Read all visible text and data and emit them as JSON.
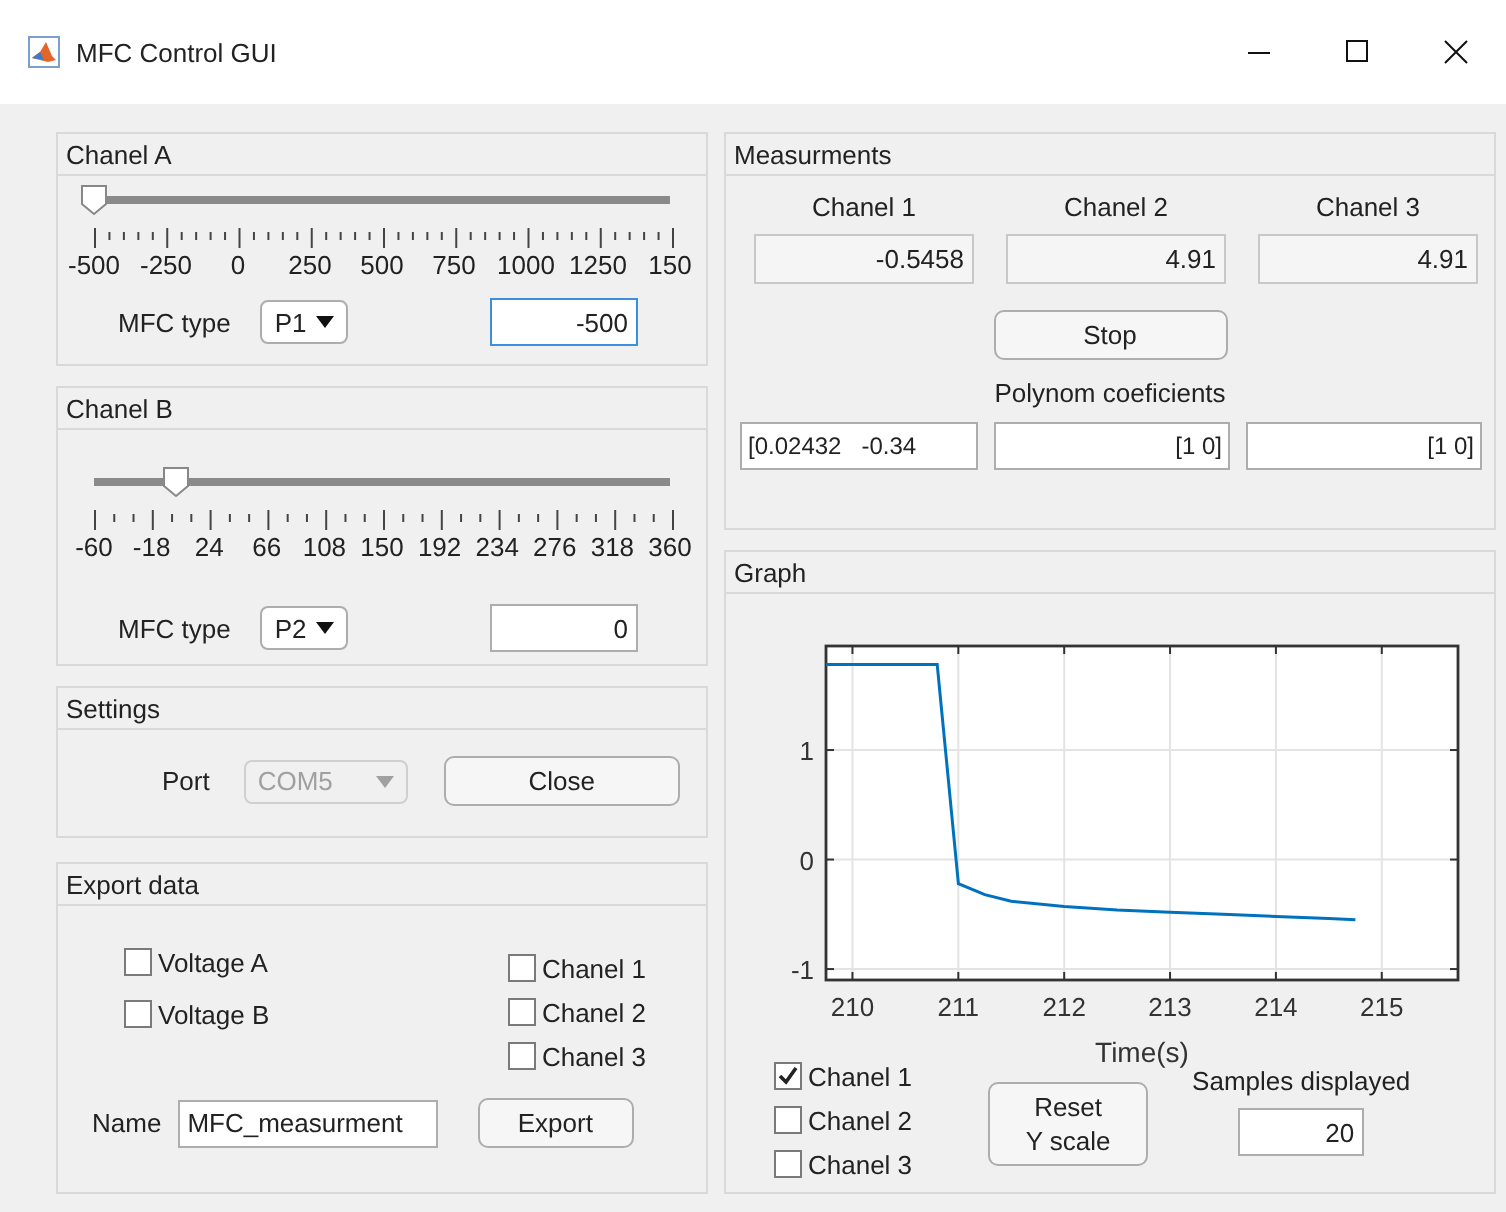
{
  "window": {
    "title": "MFC Control GUI"
  },
  "channel_panels": [
    {
      "title": "Chanel A",
      "slider": {
        "level": 0,
        "tick_labels": [
          "-500",
          "-250",
          "0",
          "250",
          "500",
          "750",
          "1000",
          "1250",
          "150"
        ]
      },
      "mfc_label": "MFC type",
      "mfc_type": "P1",
      "value": "-500",
      "focused": true
    },
    {
      "title": "Chanel B",
      "slider": {
        "level": 0.143,
        "tick_labels": [
          "-60",
          "-18",
          "24",
          "66",
          "108",
          "150",
          "192",
          "234",
          "276",
          "318",
          "360"
        ]
      },
      "mfc_label": "MFC type",
      "mfc_type": "P2",
      "value": "0",
      "focused": false
    }
  ],
  "settings": {
    "title": "Settings",
    "port_label": "Port",
    "port": "COM5",
    "port_disabled": true,
    "button": "Close"
  },
  "export": {
    "title": "Export data",
    "checkboxes_left": [
      {
        "label": "Voltage A",
        "checked": false
      },
      {
        "label": "Voltage B",
        "checked": false
      }
    ],
    "checkboxes_right": [
      {
        "label": "Chanel 1",
        "checked": false
      },
      {
        "label": "Chanel 2",
        "checked": false
      },
      {
        "label": "Chanel 3",
        "checked": false
      }
    ],
    "name_label": "Name",
    "name_value": "MFC_measurment",
    "button": "Export"
  },
  "measurements": {
    "title": "Measurments",
    "channels": [
      {
        "label": "Chanel 1",
        "value": "-0.5458"
      },
      {
        "label": "Chanel 2",
        "value": "4.91"
      },
      {
        "label": "Chanel 3",
        "value": "4.91"
      }
    ],
    "button": "Stop",
    "poly_label": "Polynom coeficients",
    "poly_fields": [
      "[0.02432   -0.34",
      "[1 0]",
      "[1 0]"
    ]
  },
  "graph": {
    "title": "Graph",
    "chart_data": {
      "type": "line",
      "xlabel": "Time(s)",
      "grid": true,
      "xlim": [
        209.75,
        215.72
      ],
      "ylim": [
        -1.1,
        1.95
      ],
      "xticks": [
        210,
        211,
        212,
        213,
        214,
        215
      ],
      "yticks": [
        -1,
        0,
        1
      ],
      "x": [
        209.75,
        210.8,
        211.0,
        211.25,
        211.5,
        212,
        212.5,
        213,
        213.5,
        214,
        214.5,
        214.75
      ],
      "series": [
        {
          "color": "#0072bd",
          "values": [
            1.78,
            1.78,
            -0.22,
            -0.32,
            -0.38,
            -0.43,
            -0.46,
            -0.48,
            -0.5,
            -0.52,
            -0.54,
            -0.55
          ]
        }
      ]
    },
    "channel_checks": [
      {
        "label": "Chanel 1",
        "checked": true
      },
      {
        "label": "Chanel 2",
        "checked": false
      },
      {
        "label": "Chanel 3",
        "checked": false
      }
    ],
    "reset_button": "Reset\nY scale",
    "samples_label": "Samples displayed",
    "samples_value": "20"
  }
}
